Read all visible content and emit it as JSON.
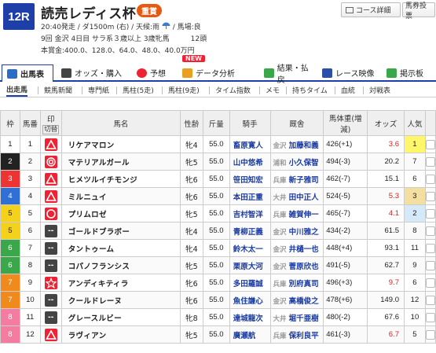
{
  "race": {
    "number": "12R",
    "title": "読売レディス杯",
    "grade": "重賞",
    "info1_a": "20:40発走 / ダ1500m (右) / 天候:雨",
    "info1_b": "/ 馬場:良",
    "info2": "9回 金沢 4日目 サラ系３歳以上 3歳牝馬　　　12頭",
    "info3": "本賞金:400.0、128.0、64.0、48.0、40.0万円"
  },
  "header_buttons": {
    "course": "コース詳細",
    "ticket": "馬券投票"
  },
  "new_badge": "NEW",
  "main_tabs": [
    {
      "label": "出馬表"
    },
    {
      "label": "オッズ・購入"
    },
    {
      "label": "予想"
    },
    {
      "label": "データ分析"
    },
    {
      "label": "結果・払戻"
    },
    {
      "label": "レース映像"
    },
    {
      "label": "掲示板"
    }
  ],
  "sub_tabs": [
    {
      "label": "出走馬"
    },
    {
      "label": "競馬新聞"
    },
    {
      "label": "専門紙"
    },
    {
      "label": "馬柱(5走)"
    },
    {
      "label": "馬柱(9走)"
    },
    {
      "label": "タイム指数"
    },
    {
      "label": "メモ"
    },
    {
      "label": "持ちタイム"
    },
    {
      "label": "血統"
    },
    {
      "label": "対戦表"
    }
  ],
  "table_headers": {
    "waku": "枠",
    "umaban": "馬番",
    "mark_top": "印",
    "mark_bottom": "切替",
    "name": "馬名",
    "sex_age": "性齢",
    "kinryo": "斤量",
    "jockey": "騎手",
    "trainer": "厩舎",
    "weight": "馬体重(増減)",
    "odds": "オッズ",
    "pop": "人気"
  },
  "colors": {
    "accent": "#1e3ea8",
    "odds_red": "#dd2222",
    "mark_red": "#ee2233"
  },
  "horses": [
    {
      "waku": "1",
      "umaban": "1",
      "mark": "triangle",
      "name": "リケアマロン",
      "sex_age": "牝4",
      "kinryo": "55.0",
      "jockey": "畜原寛人",
      "region": "金沢",
      "trainer": "加藤和義",
      "weight": "426(+1)",
      "odds": "3.6",
      "pop": "1"
    },
    {
      "waku": "2",
      "umaban": "2",
      "mark": "target",
      "name": "マテリアルガール",
      "sex_age": "牝5",
      "kinryo": "55.0",
      "jockey": "山中悠希",
      "region": "浦和",
      "trainer": "小久保智",
      "weight": "494(-3)",
      "odds": "20.2",
      "pop": "7"
    },
    {
      "waku": "3",
      "umaban": "3",
      "mark": "triangle",
      "name": "ヒメツルイチモンジ",
      "sex_age": "牝6",
      "kinryo": "55.0",
      "jockey": "笹田知宏",
      "region": "兵庫",
      "trainer": "新子雅司",
      "weight": "462(-7)",
      "odds": "15.1",
      "pop": "6"
    },
    {
      "waku": "4",
      "umaban": "4",
      "mark": "triangle",
      "name": "ミルニュイ",
      "sex_age": "牝6",
      "kinryo": "55.0",
      "jockey": "本田正重",
      "region": "大井",
      "trainer": "田中正人",
      "weight": "524(-5)",
      "odds": "5.3",
      "pop": "3"
    },
    {
      "waku": "5",
      "umaban": "5",
      "mark": "circle",
      "name": "プリムロゼ",
      "sex_age": "牝5",
      "kinryo": "55.0",
      "jockey": "吉村智洋",
      "region": "兵庫",
      "trainer": "雑賀伸一",
      "weight": "465(-7)",
      "odds": "4.1",
      "pop": "2"
    },
    {
      "waku": "5",
      "umaban": "6",
      "mark": "none",
      "name": "ゴールドブラボー",
      "sex_age": "牝4",
      "kinryo": "55.0",
      "jockey": "青柳正義",
      "region": "金沢",
      "trainer": "中川雅之",
      "weight": "434(-2)",
      "odds": "61.5",
      "pop": "8"
    },
    {
      "waku": "6",
      "umaban": "7",
      "mark": "none",
      "name": "タントゥーム",
      "sex_age": "牝4",
      "kinryo": "55.0",
      "jockey": "鈴木太一",
      "region": "金沢",
      "trainer": "井樋一也",
      "weight": "448(+4)",
      "odds": "93.1",
      "pop": "11"
    },
    {
      "waku": "6",
      "umaban": "8",
      "mark": "none",
      "name": "コパノフランシス",
      "sex_age": "牝5",
      "kinryo": "55.0",
      "jockey": "栗原大河",
      "region": "金沢",
      "trainer": "菅原欣也",
      "weight": "491(-5)",
      "odds": "62.7",
      "pop": "9"
    },
    {
      "waku": "7",
      "umaban": "9",
      "mark": "star",
      "name": "アンディキティラ",
      "sex_age": "牝6",
      "kinryo": "55.0",
      "jockey": "多田羅誠",
      "region": "兵庫",
      "trainer": "別府真司",
      "weight": "496(+3)",
      "odds": "9.7",
      "pop": "6"
    },
    {
      "waku": "7",
      "umaban": "10",
      "mark": "none",
      "name": "クールドレーヌ",
      "sex_age": "牝6",
      "kinryo": "55.0",
      "jockey": "魚住謙心",
      "region": "金沢",
      "trainer": "高橋俊之",
      "weight": "478(+6)",
      "odds": "149.0",
      "pop": "12"
    },
    {
      "waku": "8",
      "umaban": "11",
      "mark": "none",
      "name": "グレースルビー",
      "sex_age": "牝8",
      "kinryo": "55.0",
      "jockey": "達城龍次",
      "region": "大井",
      "trainer": "堀千亜樹",
      "weight": "480(-2)",
      "odds": "67.6",
      "pop": "10"
    },
    {
      "waku": "8",
      "umaban": "12",
      "mark": "triangle",
      "name": "ラヴィアン",
      "sex_age": "牝5",
      "kinryo": "55.0",
      "jockey": "廣瀬航",
      "region": "兵庫",
      "trainer": "保利良平",
      "weight": "461(-3)",
      "odds": "6.7",
      "pop": "5"
    }
  ]
}
